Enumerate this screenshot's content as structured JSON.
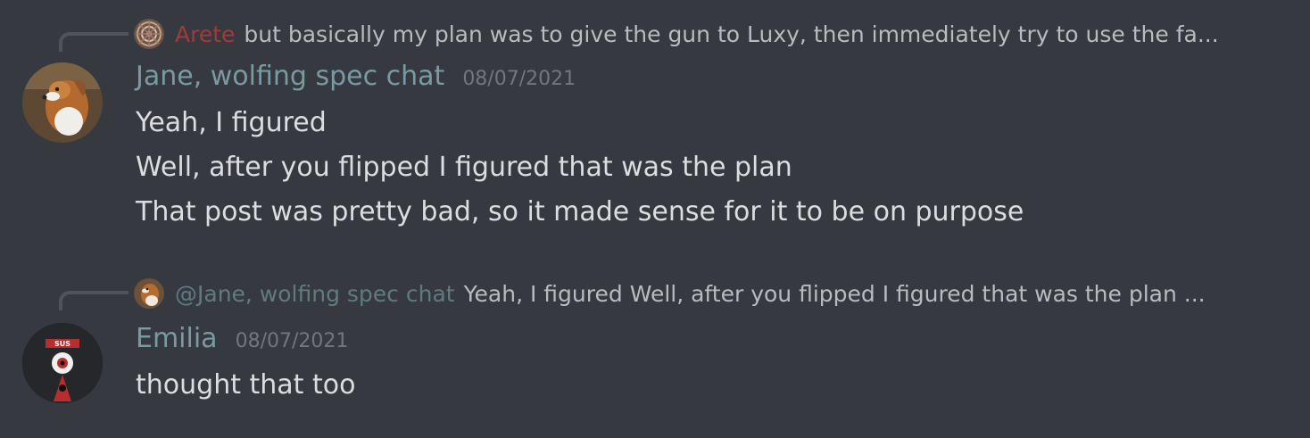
{
  "messages": [
    {
      "reply": {
        "author": "Arete",
        "author_color": "#a33a3a",
        "text": "but basically my plan was to give the gun to Luxy, then immediately try to use the fa..."
      },
      "author": "Jane, wolfing spec chat",
      "author_color": "#7a9aa3",
      "timestamp": "08/07/2021",
      "lines": [
        "Yeah, I figured",
        "Well, after you flipped I figured that was the plan",
        "That post was pretty bad, so it made sense for it to be on purpose"
      ]
    },
    {
      "reply": {
        "author": "@Jane, wolfing spec chat",
        "author_color": "#5f7b82",
        "text": "Yeah, I figured Well, after you flipped I figured that was the plan ..."
      },
      "author": "Emilia",
      "author_color": "#7a9aa3",
      "timestamp": "08/07/2021",
      "lines": [
        "thought that too"
      ]
    }
  ],
  "colors": {
    "background": "#36393f",
    "text": "#dcddde",
    "muted": "#72767d",
    "reply_spine": "#4f545c"
  },
  "avatars": {
    "arete": "mandala-avatar",
    "jane": "dog-avatar",
    "emilia": "sus-poster-avatar"
  },
  "avatar_text": {
    "emilia_poster": "SUS"
  }
}
